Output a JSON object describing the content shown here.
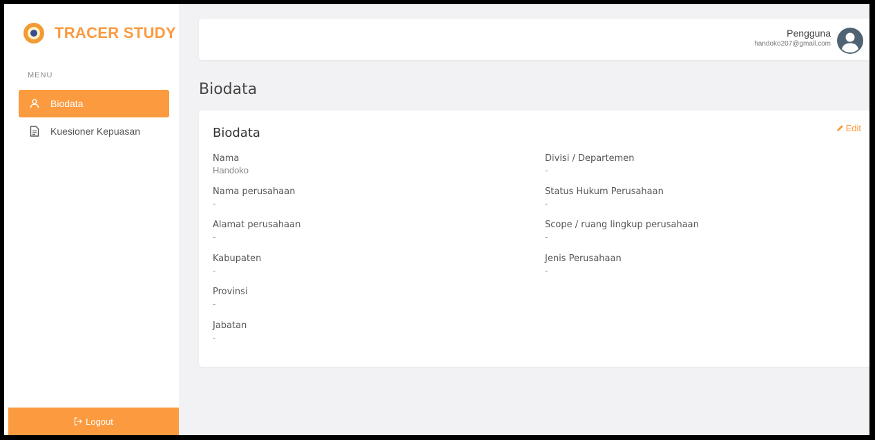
{
  "app": {
    "brand": "TRACER STUDY"
  },
  "sidebar": {
    "menu_label": "MENU",
    "items": [
      {
        "label": "Biodata",
        "icon": "user-icon",
        "active": true
      },
      {
        "label": "Kuesioner Kepuasan",
        "icon": "document-icon",
        "active": false
      }
    ],
    "logout_label": "Logout"
  },
  "header": {
    "user_role": "Pengguna",
    "user_email": "handoko207@gmail.com"
  },
  "page": {
    "title": "Biodata"
  },
  "card": {
    "title": "Biodata",
    "edit_label": "Edit",
    "left_fields": [
      {
        "label": "Nama",
        "value": "Handoko"
      },
      {
        "label": "Nama perusahaan",
        "value": "-"
      },
      {
        "label": "Alamat perusahaan",
        "value": "-"
      },
      {
        "label": "Kabupaten",
        "value": "-"
      },
      {
        "label": "Provinsi",
        "value": "-"
      },
      {
        "label": "Jabatan",
        "value": "-"
      }
    ],
    "right_fields": [
      {
        "label": "Divisi / Departemen",
        "value": "-"
      },
      {
        "label": "Status Hukum Perusahaan",
        "value": "-"
      },
      {
        "label": "Scope / ruang lingkup perusahaan",
        "value": "-"
      },
      {
        "label": "Jenis Perusahaan",
        "value": "-"
      }
    ]
  },
  "colors": {
    "accent": "#fb9a3f",
    "background": "#f2f2f4",
    "avatar": "#4f6372"
  }
}
